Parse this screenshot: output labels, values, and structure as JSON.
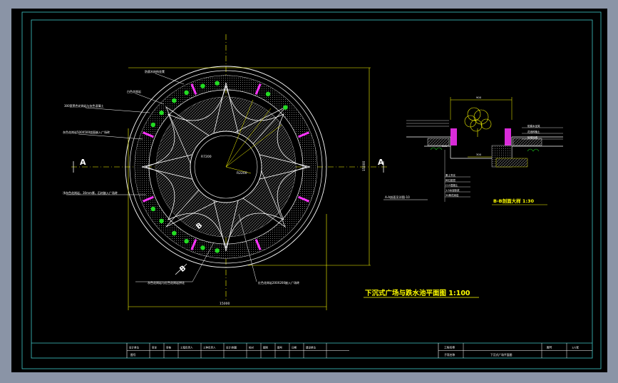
{
  "colors": {
    "frame_bg": "#8a94a6",
    "canvas": "#000000",
    "border": "#3fc7c7",
    "white": "#ffffff",
    "yellow": "#ffff00",
    "green": "#22dd22",
    "magenta": "#ff33ff",
    "hatch": "#8a8a8a"
  },
  "plan": {
    "section_mark_left": "A",
    "section_mark_right": "A",
    "section_mark_b_top": "B",
    "section_mark_b_bottom": "B",
    "dim_width": "15000",
    "dim_height": "15000",
    "dim_center": "R7200",
    "dim_radius": "R2200",
    "annotations": [
      "防腐木结构坐凳",
      "白色花岗岩",
      "300宽黑色花岗岩与灰色混凝土",
      "灰色花岗岩500X500烧面嵌入广场砖",
      "浅灰色花岗岩，30mm厚，石材嵌入广场砖",
      "灰色花岗岩与红色花岗岩拼花",
      "红色花岗岩200X200嵌入广场砖"
    ],
    "section_callout": "A-A剖面见详图-10"
  },
  "section": {
    "title": "B-B剖面大样 1:30",
    "dim_top": "900",
    "dim_mid": "300",
    "dim_bottom": "900",
    "notes": [
      "素土夯实",
      "碎石垫层",
      "C15混凝土",
      "1:3水泥砂浆",
      "30厚花岗岩",
      "防腐木坐凳",
      "花池种植土",
      "砖砌挡墙"
    ]
  },
  "main_title": "下沉式广场与跌水池平面图  1:100",
  "title_block": {
    "left_cells": [
      "设计单位",
      "审定",
      "审核",
      "工程负责人",
      "工种负责人",
      "设计/制图",
      "校对",
      "图别",
      "图号",
      "日期",
      "建设单位"
    ],
    "left_cells_row2": [
      "图号"
    ],
    "right_labels": [
      "工程名称",
      "子项名称"
    ],
    "right_value": "下沉式广场平面图",
    "sheet_label": "图号",
    "sheet_value": "1/1张"
  }
}
